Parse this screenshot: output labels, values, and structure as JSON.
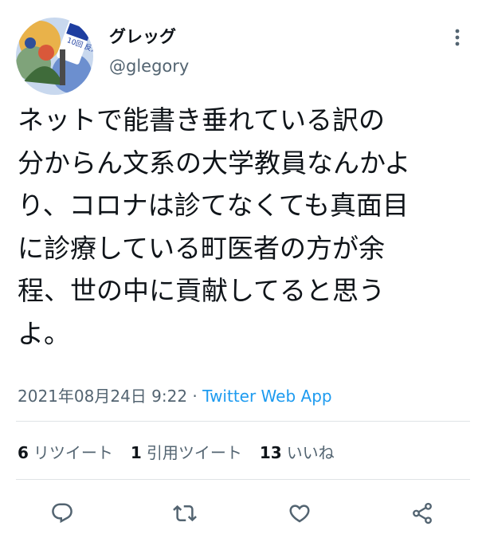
{
  "user": {
    "display_name": "グレッグ",
    "handle": "@glegory",
    "avatar_text": "10回 反逆者 ガマンの人"
  },
  "tweet": {
    "lines": [
      "ネットで能書き垂れている訳の",
      "分からん文系の大学教員なんかよ",
      "り、コロナは診てなくても真面目",
      "に診療している町医者の方が余",
      "程、世の中に貢献してると思う",
      "よ。"
    ],
    "timestamp": "2021年08月24日 9:22",
    "separator": " · ",
    "source": "Twitter Web App"
  },
  "stats": {
    "retweets_count": "6",
    "retweets_label": "リツイート",
    "quotes_count": "1",
    "quotes_label": "引用ツイート",
    "likes_count": "13",
    "likes_label": "いいね"
  },
  "icons": {
    "more": "more-vertical-icon",
    "reply": "reply-icon",
    "retweet": "retweet-icon",
    "like": "heart-icon",
    "share": "share-icon"
  },
  "colors": {
    "text": "#0f1419",
    "secondary": "#536471",
    "link": "#1d9bf0",
    "divider": "#dfe3e6"
  }
}
